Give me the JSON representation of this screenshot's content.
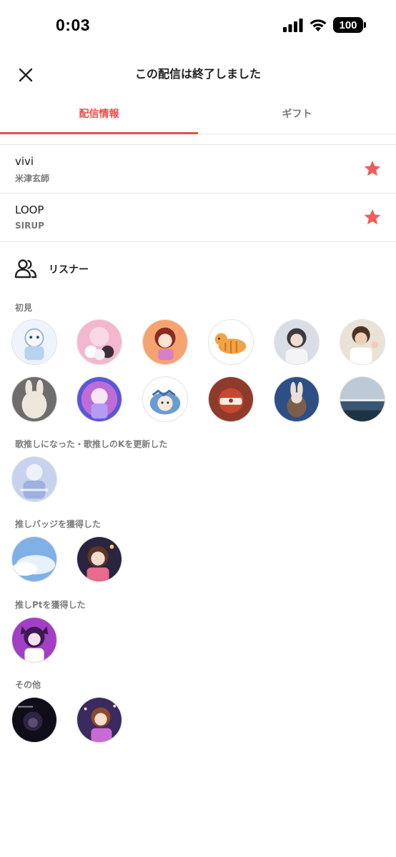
{
  "status_bar": {
    "time": "0:03",
    "battery": "100",
    "icons": [
      "cellular-signal-icon",
      "wifi-icon",
      "battery-icon"
    ]
  },
  "header": {
    "title": "この配信は終了しました",
    "close_icon": "close-icon"
  },
  "tabs": [
    {
      "label": "配信情報",
      "active": true
    },
    {
      "label": "ギフト",
      "active": false
    }
  ],
  "songs": [
    {
      "title": "vivi",
      "artist": "米津玄師",
      "favorited": true
    },
    {
      "title": "LOOP",
      "artist": "SIRUP",
      "favorited": true
    }
  ],
  "listeners": {
    "title": "リスナー",
    "icon": "people-icon",
    "groups": [
      {
        "label": "初見",
        "avatar_count": 12
      },
      {
        "label": "歌推しになった・歌推しのKを更新した",
        "avatar_count": 1
      },
      {
        "label": "推しバッジを獲得した",
        "avatar_count": 2
      },
      {
        "label": "推しPtを獲得した",
        "avatar_count": 1
      },
      {
        "label": "その他",
        "avatar_count": 2
      }
    ]
  },
  "colors": {
    "accent": "#f04a4a",
    "star": "#f25c5c",
    "muted_text": "#7d7d7d",
    "divider": "#e6e6e6"
  }
}
